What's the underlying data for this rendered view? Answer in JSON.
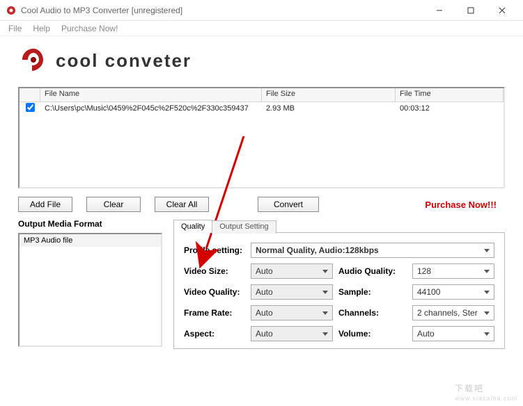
{
  "window": {
    "title": "Cool Audio to MP3 Converter  [unregistered]"
  },
  "menu": {
    "file": "File",
    "help": "Help",
    "purchase": "Purchase Now!"
  },
  "logo_text": "cool conveter",
  "filelist": {
    "headers": {
      "name": "File Name",
      "size": "File Size",
      "time": "File Time"
    },
    "rows": [
      {
        "checked": true,
        "name": "C:\\Users\\pc\\Music\\0459%2F045c%2F520c%2F330c359437",
        "size": "2.93 MB",
        "time": "00:03:12"
      }
    ]
  },
  "buttons": {
    "add": "Add File",
    "clear": "Clear",
    "clearall": "Clear All",
    "convert": "Convert",
    "purchase": "Purchase Now!!!"
  },
  "omf": {
    "label": "Output Media Format",
    "item": "MP3 Audio file"
  },
  "tabs": {
    "quality": "Quality",
    "output": "Output Setting"
  },
  "settings": {
    "profile_label": "Profile setting:",
    "profile_value": "Normal Quality, Audio:128kbps",
    "video_size_label": "Video Size:",
    "video_size_value": "Auto",
    "video_quality_label": "Video Quality:",
    "video_quality_value": "Auto",
    "frame_rate_label": "Frame Rate:",
    "frame_rate_value": "Auto",
    "aspect_label": "Aspect:",
    "aspect_value": "Auto",
    "audio_quality_label": "Audio Quality:",
    "audio_quality_value": "128",
    "sample_label": "Sample:",
    "sample_value": "44100",
    "channels_label": "Channels:",
    "channels_value": "2 channels, Ster",
    "volume_label": "Volume:",
    "volume_value": "Auto"
  },
  "watermark": {
    "main": "下载吧",
    "sub": "www.xiazaiba.com"
  }
}
